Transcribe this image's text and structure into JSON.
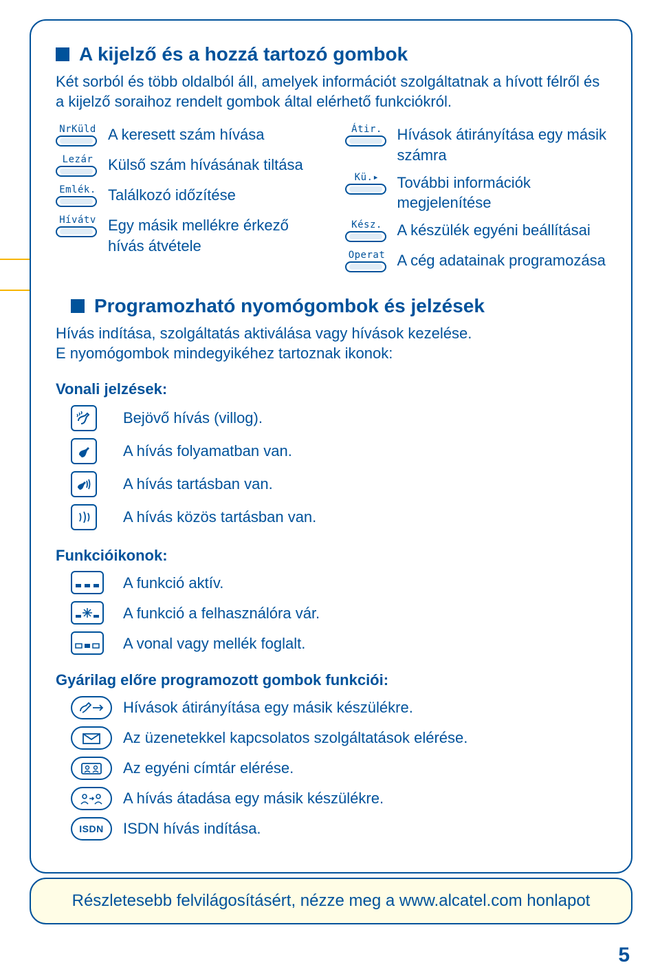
{
  "page_number": "5",
  "footer_text": "Részletesebb felvilágosításért, nézze meg a www.alcatel.com honlapot",
  "section1": {
    "title": "A kijelző és a hozzá tartozó gombok",
    "body": "Két sorból és több oldalból áll, amelyek információt szolgáltatnak a hívott félről és a kijelző soraihoz rendelt gombok által elérhető funkciókról.",
    "left": [
      {
        "tag": "NrKüld",
        "desc": "A keresett szám hívása"
      },
      {
        "tag": "Lezár",
        "desc": "Külső szám hívásának tiltása"
      },
      {
        "tag": "Emlék.",
        "desc": "Találkozó időzítése"
      },
      {
        "tag": "Hívátv",
        "desc": "Egy másik mellékre érkező hívás átvétele"
      }
    ],
    "right": [
      {
        "tag": "Átir.",
        "desc": "Hívások átirányítása egy másik számra"
      },
      {
        "tag": "Kü.▸",
        "desc": "További információk megjelenítése"
      },
      {
        "tag": "Kész.",
        "desc": "A készülék egyéni beállításai"
      },
      {
        "tag": "Operat",
        "desc": "A cég adatainak programozása"
      }
    ]
  },
  "section2": {
    "title": "Programozható nyomógombok és jelzések",
    "body": "Hívás indítása, szolgáltatás aktiválása vagy hívások kezelése.\nE nyomógombok mindegyikéhez tartoznak ikonok:",
    "line_heading": "Vonali jelzések:",
    "lines": [
      "Bejövő hívás (villog).",
      "A hívás folyamatban van.",
      "A hívás tartásban van.",
      "A hívás közös tartásban van."
    ],
    "func_heading": "Funkcióikonok:",
    "funcs": [
      "A funkció aktív.",
      "A funkció a felhasználóra vár.",
      "A vonal vagy mellék foglalt."
    ],
    "preset_heading": "Gyárilag előre programozott gombok funkciói:",
    "presets": [
      "Hívások  átirányítása egy másik készülékre.",
      "Az üzenetekkel kapcsolatos szolgáltatások elérése.",
      "Az egyéni címtár elérése.",
      "A hívás átadása egy másik készülékre.",
      "ISDN hívás indítása."
    ],
    "isdn_label": "ISDN"
  }
}
